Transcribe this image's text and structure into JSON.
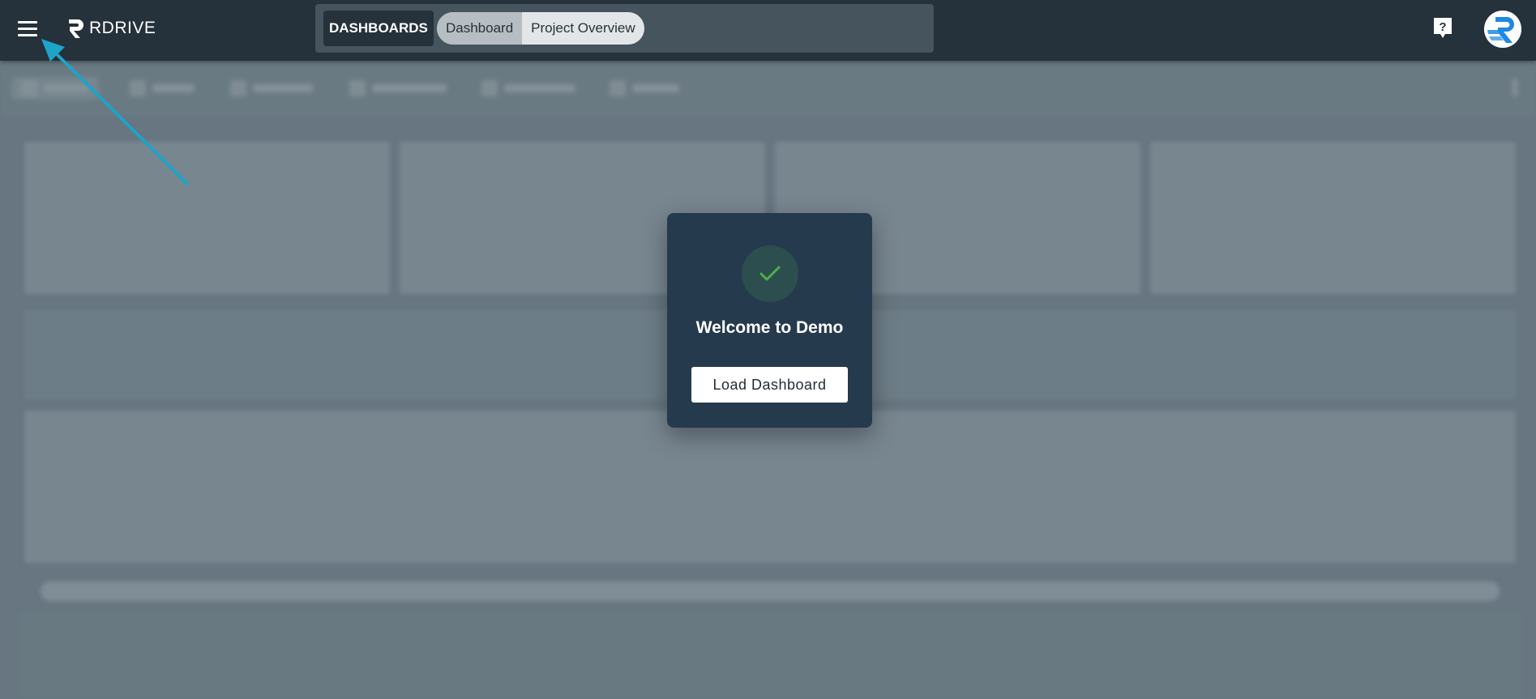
{
  "header": {
    "logo_text": "RDRIVE",
    "nav_label": "DASHBOARDS",
    "chips": [
      {
        "label": "Dashboard",
        "active": true
      },
      {
        "label": "Project Overview",
        "active": false
      }
    ],
    "help_icon": "help-question-icon",
    "avatar_icon": "rdrive-logo-avatar"
  },
  "dialog": {
    "title": "Welcome to Demo",
    "button_label": "Load Dashboard",
    "icon": "check-icon"
  },
  "colors": {
    "topbar": "#25313b",
    "nav_group": "#46545e",
    "dialog_bg": "#263a4d",
    "check_circle": "#2c4e4e",
    "check_mark": "#4caf50",
    "arrow": "#1ea3c9",
    "avatar_accent": "#1e88e5",
    "page_bg": "#6b7b86"
  }
}
